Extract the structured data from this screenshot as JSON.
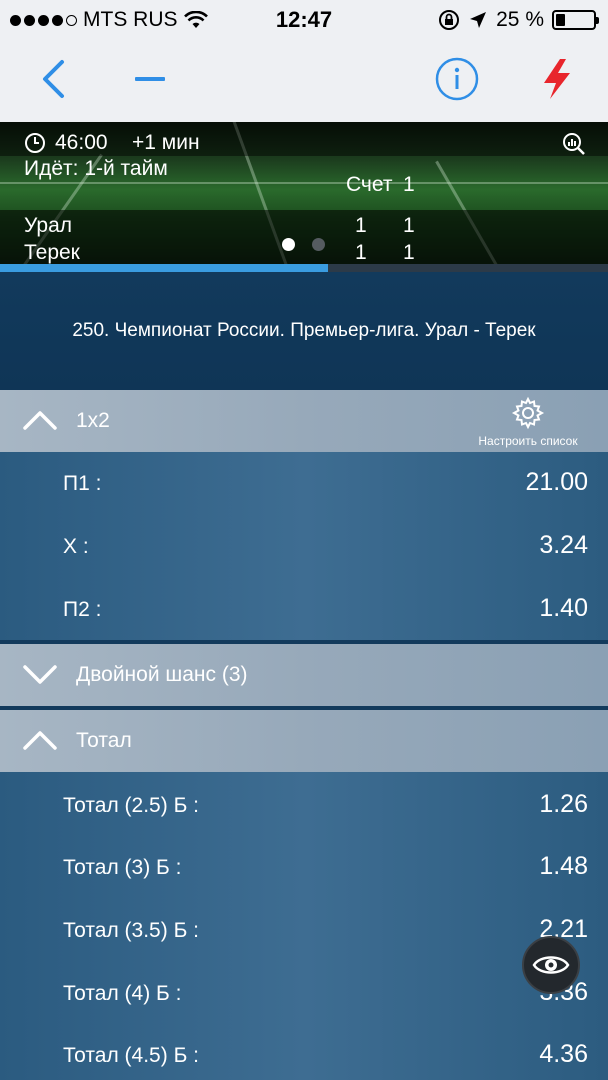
{
  "status_bar": {
    "carrier": "MTS RUS",
    "time": "12:47",
    "battery_percent": "25 %",
    "battery_level": 0.25,
    "signal_bars": 4,
    "icons": [
      "signal-dots-icon",
      "wifi-icon",
      "orientation-lock-icon",
      "location-arrow-icon",
      "battery-icon"
    ]
  },
  "nav": {
    "icons": [
      "back-chevron-icon",
      "minus-icon",
      "info-icon",
      "lightning-icon"
    ],
    "accent": "#2f8ee6",
    "lightning_color": "#e8252c"
  },
  "match": {
    "time": "46:00",
    "extra": "+1 мин",
    "status": "Идёт: 1-й  тайм",
    "score_label": "Счет",
    "period": "1",
    "teams": [
      {
        "name": "Урал",
        "score_total": "1",
        "score_period": "1"
      },
      {
        "name": "Терек",
        "score_total": "1",
        "score_period": "1"
      }
    ],
    "progress": 0.54,
    "page_count": 2,
    "active_page": 1
  },
  "event_title": "250. Чемпионат России. Премьер-лига. Урал - Терек",
  "sections": [
    {
      "label": "1x2",
      "expanded": true,
      "settings_label": "Настроить список",
      "rows": [
        {
          "name": "П1 :",
          "value": "21.00"
        },
        {
          "name": "X :",
          "value": "3.24"
        },
        {
          "name": "П2 :",
          "value": "1.40"
        }
      ]
    },
    {
      "label": "Двойной шанс (3)",
      "expanded": false
    },
    {
      "label": "Тотал",
      "expanded": true,
      "rows": [
        {
          "name": "Тотал (2.5) Б :",
          "value": "1.26"
        },
        {
          "name": "Тотал (3) Б :",
          "value": "1.48"
        },
        {
          "name": "Тотал (3.5) Б :",
          "value": "2.21"
        },
        {
          "name": "Тотал (4) Б :",
          "value": "3.36"
        },
        {
          "name": "Тотал (4.5) Б :",
          "value": "4.36"
        }
      ]
    }
  ],
  "floating_button": {
    "icon": "eye-icon"
  }
}
